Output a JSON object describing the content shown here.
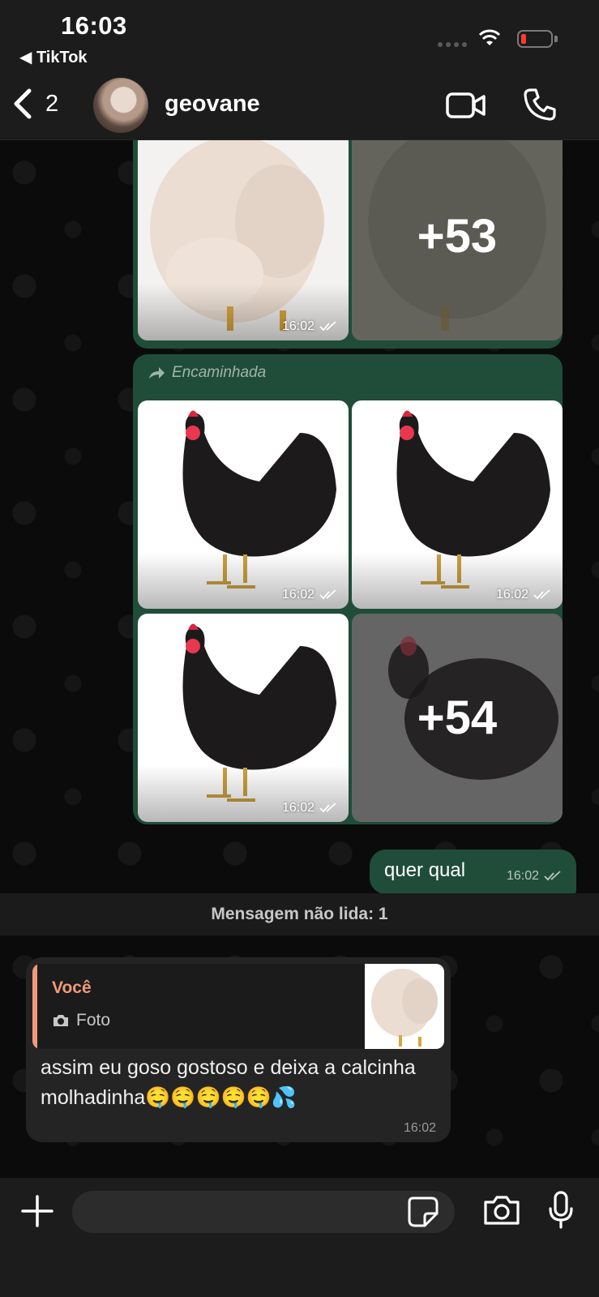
{
  "status_bar": {
    "time": "16:03",
    "back_app": "◀ TikTok"
  },
  "header": {
    "unread_count": "2",
    "contact_name": "geovane"
  },
  "gallery_top": {
    "time": "16:02",
    "more_count": "+53"
  },
  "gallery_forwarded": {
    "forward_label": "Encaminhada",
    "times": [
      "16:02",
      "16:02",
      "16:02"
    ],
    "more_count": "+54"
  },
  "text_message": {
    "text": "quer qual",
    "time": "16:02"
  },
  "unread_banner": "Mensagem não lida: 1",
  "incoming": {
    "quote_author": "Você",
    "quote_type": "Foto",
    "text": "assim eu goso gostoso e deixa a calcinha molhadinha🤤🤤🤤🤤🤤💦",
    "time": "16:02"
  },
  "colors": {
    "outgoing_bubble": "#1f4d3a",
    "incoming_bubble": "#242424",
    "quote_accent": "#f09a7b",
    "battery_low": "#ff3b30"
  },
  "icons": [
    "back-chevron",
    "video-call",
    "phone",
    "forward-arrow",
    "double-check",
    "camera",
    "plus",
    "sticker",
    "microphone"
  ]
}
